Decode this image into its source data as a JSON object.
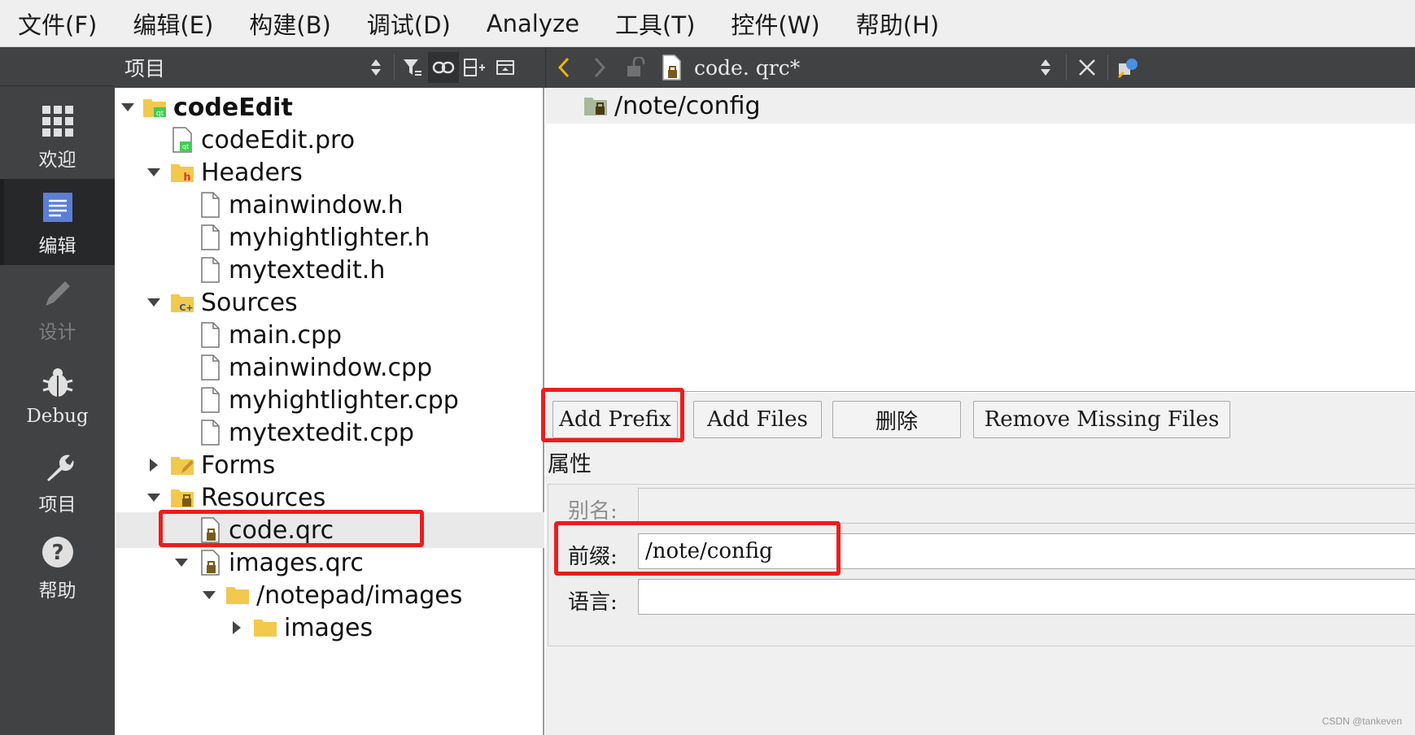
{
  "menubar": {
    "items": [
      "文件(F)",
      "编辑(E)",
      "构建(B)",
      "调试(D)",
      "Analyze",
      "工具(T)",
      "控件(W)",
      "帮助(H)"
    ]
  },
  "modebar": {
    "modes": [
      {
        "label": "欢迎",
        "icon": "grid-icon",
        "state": "normal"
      },
      {
        "label": "编辑",
        "icon": "document-icon",
        "state": "active"
      },
      {
        "label": "设计",
        "icon": "pencil-icon",
        "state": "disabled"
      },
      {
        "label": "Debug",
        "icon": "bug-icon",
        "state": "normal"
      },
      {
        "label": "项目",
        "icon": "wrench-icon",
        "state": "normal"
      },
      {
        "label": "帮助",
        "icon": "help-icon",
        "state": "normal"
      }
    ]
  },
  "project_panel": {
    "title": "项目",
    "tools": [
      "sort-icon",
      "filter-icon",
      "link-icon",
      "split-add-icon",
      "close-panel-icon"
    ]
  },
  "tree": [
    {
      "label": "codeEdit",
      "icon": "qt-project-icon",
      "arrow": "down",
      "bold": true
    },
    {
      "label": "codeEdit.pro",
      "icon": "qt-pro-file-icon",
      "arrow": "none"
    },
    {
      "label": "Headers",
      "icon": "header-folder-icon",
      "arrow": "down"
    },
    {
      "label": "mainwindow.h",
      "icon": "file-icon",
      "arrow": "none"
    },
    {
      "label": "myhightlighter.h",
      "icon": "file-icon",
      "arrow": "none"
    },
    {
      "label": "mytextedit.h",
      "icon": "file-icon",
      "arrow": "none"
    },
    {
      "label": "Sources",
      "icon": "cpp-folder-icon",
      "arrow": "down"
    },
    {
      "label": "main.cpp",
      "icon": "file-icon",
      "arrow": "none"
    },
    {
      "label": "mainwindow.cpp",
      "icon": "file-icon",
      "arrow": "none"
    },
    {
      "label": "myhightlighter.cpp",
      "icon": "file-icon",
      "arrow": "none"
    },
    {
      "label": "mytextedit.cpp",
      "icon": "file-icon",
      "arrow": "none"
    },
    {
      "label": "Forms",
      "icon": "forms-folder-icon",
      "arrow": "right"
    },
    {
      "label": "Resources",
      "icon": "resources-folder-icon",
      "arrow": "down"
    },
    {
      "label": "code.qrc",
      "icon": "qrc-file-icon",
      "arrow": "none",
      "selected": true
    },
    {
      "label": "images.qrc",
      "icon": "qrc-file-icon",
      "arrow": "down"
    },
    {
      "label": "/notepad/images",
      "icon": "folder-icon",
      "arrow": "down"
    },
    {
      "label": "images",
      "icon": "folder-icon",
      "arrow": "right"
    }
  ],
  "editor_bar": {
    "file_name": "code. qrc*"
  },
  "resource_editor": {
    "prefix": "/note/config",
    "buttons": {
      "add_prefix": "Add Prefix",
      "add_files": "Add Files",
      "delete": "删除",
      "remove_missing": "Remove Missing Files"
    },
    "properties_title": "属性",
    "alias_label": "别名:",
    "alias_value": "",
    "prefix_label": "前缀:",
    "prefix_value": "/note/config",
    "language_label": "语言:",
    "language_value": ""
  },
  "watermark": "CSDN @tankeven",
  "colors": {
    "highlight_red": "#ee1c1c",
    "dark_panel": "#404244",
    "active_mode": "#26282a"
  }
}
